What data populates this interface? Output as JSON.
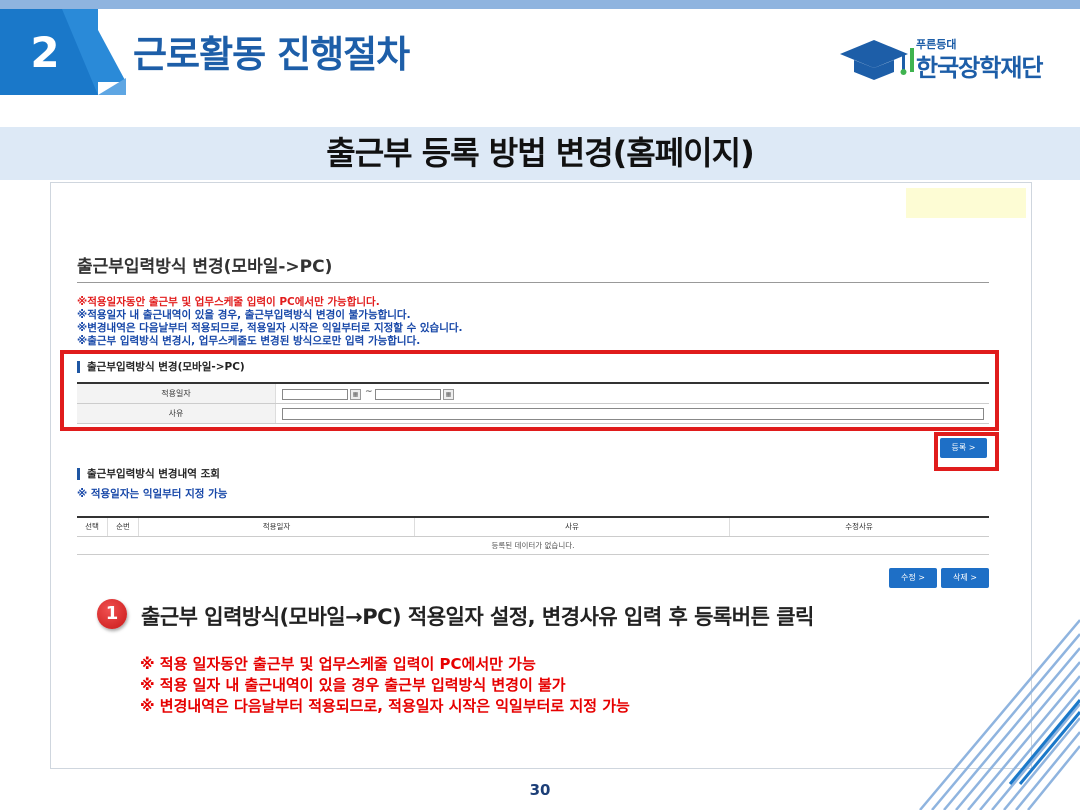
{
  "header": {
    "section_number": "2",
    "title": "근로활동 진행절차",
    "logo_small": "푸른등대",
    "logo_main": "한국장학재단"
  },
  "subheading": "출근부 등록 방법 변경(홈페이지)",
  "form": {
    "title": "출근부입력방식 변경(모바일->PC)",
    "notes": [
      "※적용일자동안 출근부 및 업무스케줄 입력이 PC에서만 가능합니다.",
      "※적용일자 내 출근내역이 있을 경우, 출근부입력방식 변경이 불가능합니다.",
      "※변경내역은 다음날부터 적용되므로, 적용일자 시작은 익일부터로 지정할 수 있습니다.",
      "※출근부 입력방식 변경시, 업무스케줄도 변경된 방식으로만 입력 가능합니다."
    ],
    "section_label": "출근부입력방식 변경(모바일->PC)",
    "date_label": "적용일자",
    "date_separator": "~",
    "reason_label": "사유",
    "register_button": "등록 >"
  },
  "history": {
    "section_label": "출근부입력방식 변경내역 조회",
    "note": "※ 적용일자는 익일부터 지정 가능",
    "columns": [
      "선택",
      "순번",
      "적용일자",
      "사유",
      "수정사유"
    ],
    "empty_message": "등록된 데이터가 없습니다.",
    "edit_button": "수정 >",
    "delete_button": "삭제 >"
  },
  "instruction": {
    "step_number": "1",
    "text": "출근부 입력방식(모바일→PC) 적용일자 설정, 변경사유 입력 후 등록버튼 클릭",
    "warnings": [
      "※ 적용 일자동안 출근부 및 업무스케줄 입력이 PC에서만 가능",
      "※ 적용 일자 내 출근내역이 있을 경우 출근부 입력방식 변경이 불가",
      "※ 변경내역은 다음날부터 적용되므로, 적용일자 시작은 익일부터로 지정 가능"
    ]
  },
  "page_number": "30",
  "colors": {
    "accent": "#1a78c9",
    "title": "#1d5ea8",
    "highlight": "#e01c1c",
    "button": "#1e6fc6"
  }
}
